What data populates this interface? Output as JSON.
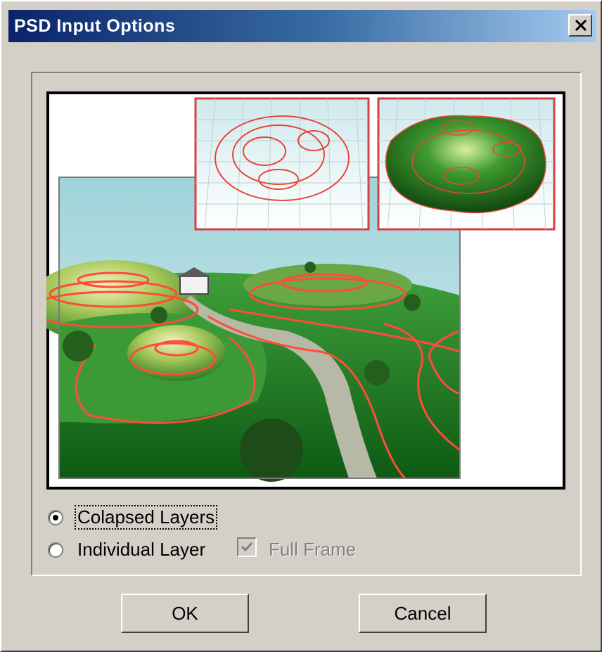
{
  "window": {
    "title": "PSD Input Options"
  },
  "preview": {
    "icon": "terrain-preview-image"
  },
  "options": {
    "collapsed_label": "Colapsed Layers",
    "individual_label": "Individual Layer",
    "full_frame_label": "Full Frame",
    "collapsed_selected": true,
    "full_frame_checked": true,
    "full_frame_enabled": false
  },
  "buttons": {
    "ok": "OK",
    "cancel": "Cancel"
  },
  "colors": {
    "titlebar_start": "#0a246a",
    "titlebar_end": "#a6caf0",
    "face": "#d4d0c8"
  }
}
